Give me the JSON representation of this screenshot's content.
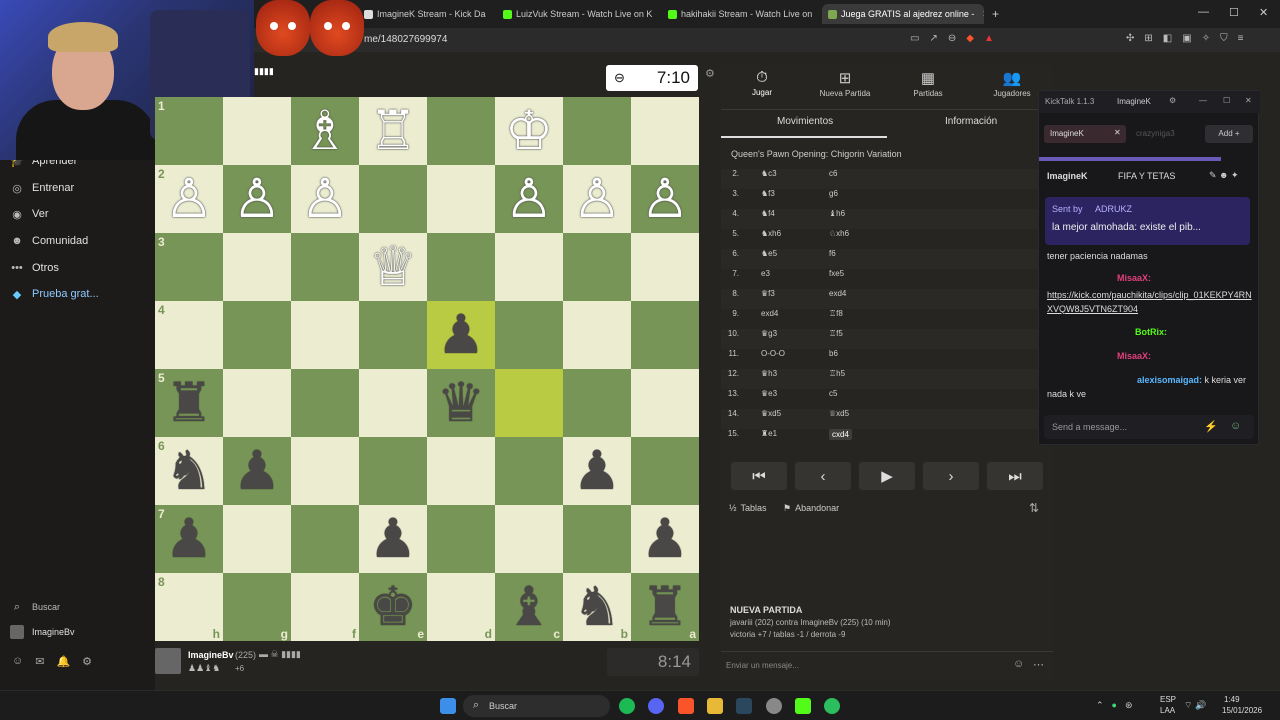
{
  "browser": {
    "tabs": [
      {
        "label": "ImagineK Stream - Kick Dashboa"
      },
      {
        "label": "LuizVuk Stream - Watch Live on K"
      },
      {
        "label": "hakihakii Stream - Watch Live on"
      },
      {
        "label": "Juega GRATIS al ajedrez online -"
      }
    ],
    "url": "me/148027699974"
  },
  "sidebar": {
    "items": [
      {
        "label": "Aprender",
        "icon": "graduation-cap-icon"
      },
      {
        "label": "Entrenar",
        "icon": "target-icon"
      },
      {
        "label": "Ver",
        "icon": "binoculars-icon"
      },
      {
        "label": "Comunidad",
        "icon": "users-icon"
      },
      {
        "label": "Otros",
        "icon": "more-icon"
      },
      {
        "label": "Prueba grat...",
        "icon": "diamond-icon"
      }
    ],
    "search_label": "Buscar",
    "username": "ImagineBv"
  },
  "board": {
    "ranks": [
      "1",
      "2",
      "3",
      "4",
      "5",
      "6",
      "7",
      "8"
    ],
    "files": [
      "h",
      "g",
      "f",
      "e",
      "d",
      "c",
      "b",
      "a"
    ],
    "orientation": "black-bottom",
    "rows": [
      [
        " ",
        " ",
        "♗",
        "♖",
        " ",
        "♔",
        " ",
        " "
      ],
      [
        "♙",
        "♙",
        "♙",
        " ",
        " ",
        "♙",
        "♙",
        "♙"
      ],
      [
        " ",
        " ",
        " ",
        "♕",
        " ",
        " ",
        " ",
        " "
      ],
      [
        " ",
        " ",
        " ",
        " ",
        "♟",
        " ",
        " ",
        " "
      ],
      [
        "♜",
        " ",
        " ",
        " ",
        "♛",
        " ",
        " ",
        " "
      ],
      [
        "♞",
        "♟",
        " ",
        " ",
        " ",
        " ",
        "♟",
        " "
      ],
      [
        "♟",
        " ",
        " ",
        "♟",
        " ",
        " ",
        " ",
        "♟"
      ],
      [
        " ",
        " ",
        " ",
        "♚",
        " ",
        "♝",
        "♞",
        "♜"
      ]
    ],
    "white_pieces": [
      "♗",
      "♖",
      "♔",
      "♙",
      "♕"
    ],
    "highlights": [
      {
        "row": 3,
        "col": 4,
        "kind": "hl"
      },
      {
        "row": 4,
        "col": 5,
        "kind": "hl"
      }
    ]
  },
  "clocks": {
    "top": "7:10",
    "bottom": "8:14"
  },
  "player": {
    "name": "ImagineBv",
    "rating": "(225)",
    "extra": "+6"
  },
  "panel": {
    "tabs": [
      {
        "label": "Jugar",
        "icon": "stopwatch-icon"
      },
      {
        "label": "Nueva Partida",
        "icon": "plus-icon"
      },
      {
        "label": "Partidas",
        "icon": "grid-icon"
      },
      {
        "label": "Jugadores",
        "icon": "players-icon"
      }
    ],
    "subtabs": [
      "Movimientos",
      "Información"
    ],
    "opening": "Queen's Pawn Opening: Chigorin Variation",
    "moves": [
      {
        "n": "2.",
        "w": "♞c3",
        "b": "c6"
      },
      {
        "n": "3.",
        "w": "♞f3",
        "b": "g6"
      },
      {
        "n": "4.",
        "w": "♞f4",
        "b": "♝h6"
      },
      {
        "n": "5.",
        "w": "♞xh6",
        "b": "♘xh6"
      },
      {
        "n": "6.",
        "w": "♞e5",
        "b": "f6"
      },
      {
        "n": "7.",
        "w": "e3",
        "b": "fxe5"
      },
      {
        "n": "8.",
        "w": "♛f3",
        "b": "exd4"
      },
      {
        "n": "9.",
        "w": "exd4",
        "b": "♖f8"
      },
      {
        "n": "10.",
        "w": "♛g3",
        "b": "♖f5"
      },
      {
        "n": "11.",
        "w": "O-O-O",
        "b": "b6"
      },
      {
        "n": "12.",
        "w": "♛h3",
        "b": "♖h5"
      },
      {
        "n": "13.",
        "w": "♛e3",
        "b": "c5"
      },
      {
        "n": "14.",
        "w": "♛xd5",
        "b": "♕xd5"
      },
      {
        "n": "15.",
        "w": "♜e1",
        "b": "cxd4"
      }
    ],
    "actions": {
      "draw": "Tablas",
      "resign": "Abandonar"
    },
    "new_game_title": "NUEVA PARTIDA",
    "new_game_line1": "javariii (202) contra ImagineBv (225) (10 min)",
    "new_game_line2": "victoria +7 / tablas -1 / derrota -9",
    "message_placeholder": "Enviar un mensaje..."
  },
  "kick": {
    "title": "KickTalk 1.1.3",
    "channel": "ImagineK",
    "tab_active": "ImagineK",
    "tab_other": "crazyniga3",
    "add_label": "Add",
    "stream_user": "ImagineK",
    "stream_title": "FIFA Y TETAS",
    "pinned_by": "Sent by",
    "pinned_user": "ADRUKZ",
    "pinned_text": "la mejor almohada: existe el pib...",
    "msg_patience": "tener paciencia nadamas",
    "msg_user1": "MisaaX:",
    "msg_link": "https://kick.com/pauchikita/clips/clip_01KEKPY4RNXVQW8J5VTN6ZT904",
    "msg_user2": "BotRix:",
    "msg_user3": "MisaaX:",
    "msg_user4": "alexisomaigad:",
    "msg_text4": "k keria ver nada k ve",
    "send_placeholder": "Send a message..."
  },
  "taskbar": {
    "search": "Buscar",
    "lang1": "ESP",
    "lang2": "LAA",
    "time": "1:49",
    "date": "15/01/2026"
  }
}
